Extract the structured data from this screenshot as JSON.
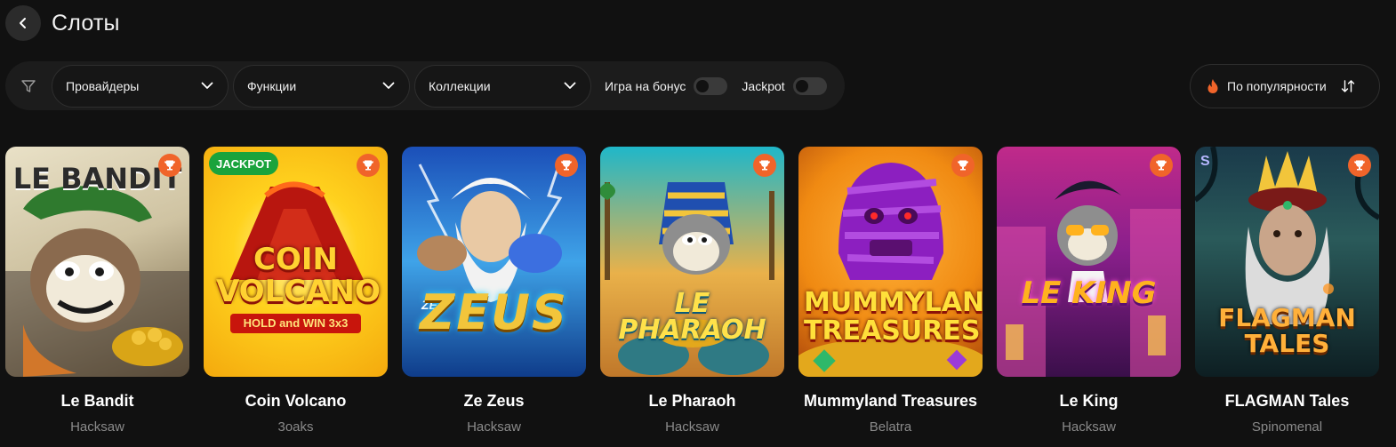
{
  "header": {
    "title": "Слоты"
  },
  "filters": {
    "dropdowns": [
      {
        "label": "Провайдеры"
      },
      {
        "label": "Функции"
      },
      {
        "label": "Коллекции"
      }
    ],
    "toggles": [
      {
        "label": "Игра на бонус",
        "on": false
      },
      {
        "label": "Jackpot",
        "on": false
      }
    ]
  },
  "sort": {
    "label": "По популярности",
    "icon": "fire-icon",
    "accent": "#f0642a"
  },
  "games": [
    {
      "name": "Le Bandit",
      "provider": "Hacksaw",
      "art_title": "LE BANDIT",
      "badge": ""
    },
    {
      "name": "Coin Volcano",
      "provider": "3oaks",
      "art_title": "COIN VOLCANO",
      "art_subtitle": "HOLD and WIN 3x3",
      "badge": "JACKPOT"
    },
    {
      "name": "Ze Zeus",
      "provider": "Hacksaw",
      "art_title": "ZEUS",
      "art_prefix": "ZE",
      "badge": ""
    },
    {
      "name": "Le Pharaoh",
      "provider": "Hacksaw",
      "art_title": "LE PHARAOH",
      "badge": ""
    },
    {
      "name": "Mummyland Treasures",
      "provider": "Belatra",
      "art_title": "MUMMYLAND TREASURES",
      "badge": ""
    },
    {
      "name": "Le King",
      "provider": "Hacksaw",
      "art_title": "LE KING",
      "badge": ""
    },
    {
      "name": "FLAGMAN Tales",
      "provider": "Spinomenal",
      "art_title": "FLAGMAN TALES",
      "badge": ""
    }
  ],
  "colors": {
    "trophy_badge": "#f0642a",
    "jackpot_badge": "#1aa33c"
  }
}
